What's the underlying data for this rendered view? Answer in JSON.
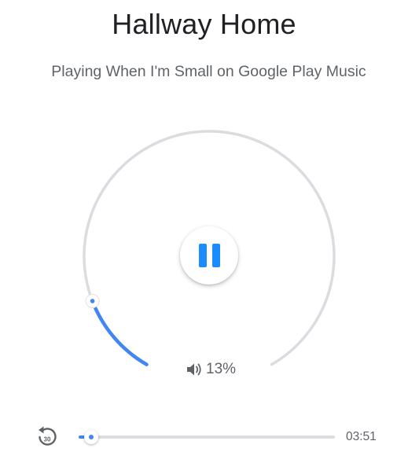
{
  "device": {
    "name": "Hallway Home"
  },
  "now_playing": {
    "status_text": "Playing When I'm Small on Google Play Music"
  },
  "volume": {
    "percent_label": "13%",
    "level": 0.13,
    "icon": "speaker-icon"
  },
  "playback": {
    "state_icon": "pause-icon",
    "replay_icon": "replay-30-icon",
    "replay_label": "30",
    "progress": 0.05,
    "duration": "03:51"
  },
  "colors": {
    "accent": "#4285f4",
    "pause_blue": "#1a8cff",
    "track_gray": "#dadce0",
    "title_text": "#202124",
    "secondary_text": "#5f6368"
  }
}
